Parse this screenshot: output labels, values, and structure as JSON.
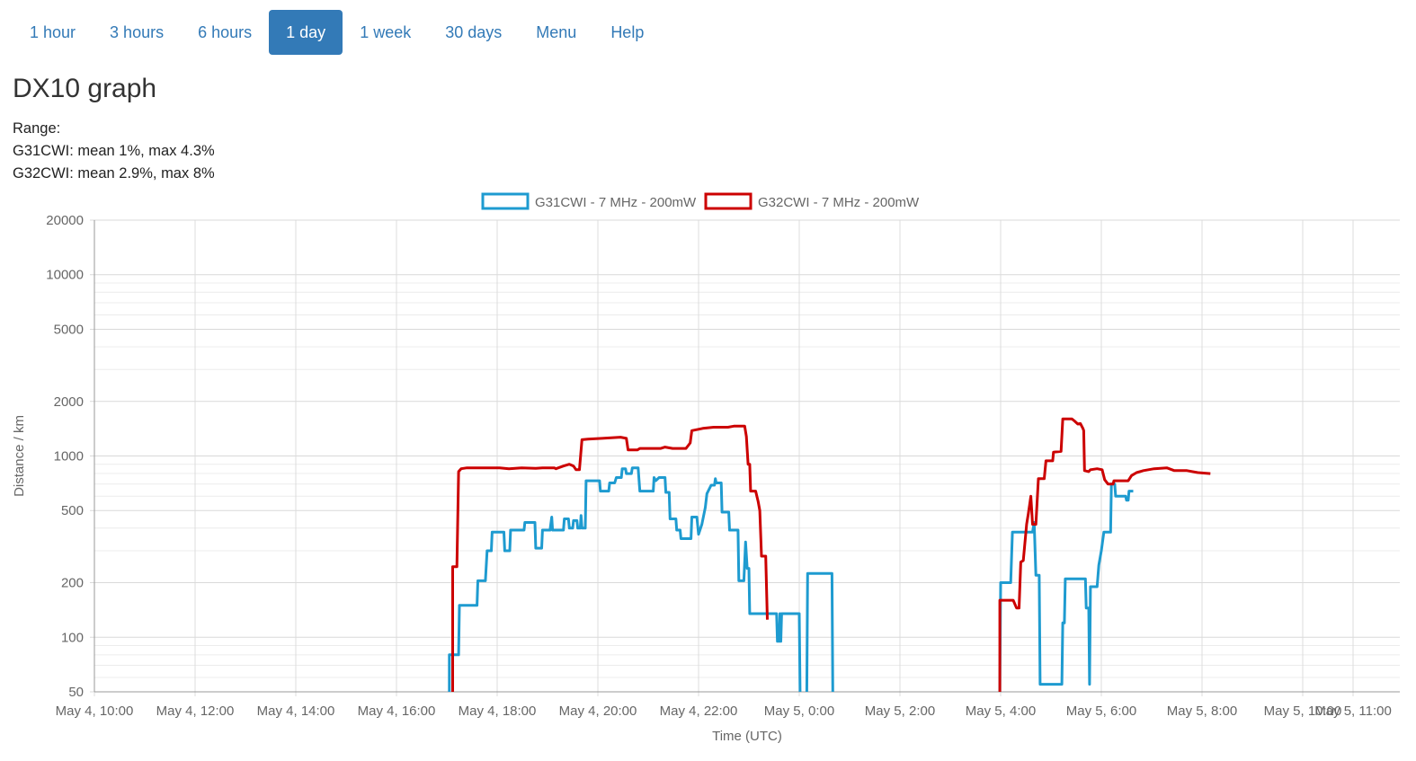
{
  "nav": {
    "tabs": [
      {
        "label": "1 hour",
        "active": false
      },
      {
        "label": "3 hours",
        "active": false
      },
      {
        "label": "6 hours",
        "active": false
      },
      {
        "label": "1 day",
        "active": true
      },
      {
        "label": "1 week",
        "active": false
      },
      {
        "label": "30 days",
        "active": false
      },
      {
        "label": "Menu",
        "active": false
      },
      {
        "label": "Help",
        "active": false
      }
    ]
  },
  "page": {
    "title": "DX10 graph",
    "range_label": "Range:",
    "stats": [
      "G31CWI: mean 1%, max 4.3%",
      "G32CWI: mean 2.9%, max 8%"
    ]
  },
  "chart_data": {
    "type": "line",
    "xlabel": "Time (UTC)",
    "ylabel": "Distance / km",
    "yscale": "log",
    "ylim": [
      50,
      20000
    ],
    "xlim": [
      "2019-05-04 10:00",
      "2019-05-05 11:00"
    ],
    "yticks": [
      50,
      100,
      200,
      500,
      1000,
      2000,
      5000,
      10000,
      20000
    ],
    "xticks": [
      "May 4, 10:00",
      "May 4, 12:00",
      "May 4, 14:00",
      "May 4, 16:00",
      "May 4, 18:00",
      "May 4, 20:00",
      "May 4, 22:00",
      "May 5, 0:00",
      "May 5, 2:00",
      "May 5, 4:00",
      "May 5, 6:00",
      "May 5, 8:00",
      "May 5, 10:00",
      "May 5, 11:00"
    ],
    "grid": true,
    "legend": "top-center",
    "series": [
      {
        "name": "G31CWI - 7 MHz - 200mW",
        "color": "#1e9bd0",
        "segments": [
          [
            [
              "2019-05-04 17:03",
              50
            ],
            [
              "2019-05-04 17:03",
              80
            ],
            [
              "2019-05-04 17:14",
              80
            ],
            [
              "2019-05-04 17:15",
              150
            ],
            [
              "2019-05-04 17:36",
              150
            ],
            [
              "2019-05-04 17:37",
              205
            ],
            [
              "2019-05-04 17:46",
              205
            ],
            [
              "2019-05-04 17:48",
              300
            ],
            [
              "2019-05-04 17:53",
              300
            ],
            [
              "2019-05-04 17:54",
              380
            ],
            [
              "2019-05-04 18:08",
              380
            ],
            [
              "2019-05-04 18:09",
              300
            ],
            [
              "2019-05-04 18:15",
              300
            ],
            [
              "2019-05-04 18:16",
              390
            ],
            [
              "2019-05-04 18:32",
              390
            ],
            [
              "2019-05-04 18:33",
              430
            ],
            [
              "2019-05-04 18:45",
              430
            ],
            [
              "2019-05-04 18:46",
              310
            ],
            [
              "2019-05-04 18:53",
              310
            ],
            [
              "2019-05-04 18:54",
              390
            ],
            [
              "2019-05-04 19:03",
              390
            ],
            [
              "2019-05-04 19:05",
              460
            ],
            [
              "2019-05-04 19:06",
              390
            ],
            [
              "2019-05-04 19:19",
              390
            ],
            [
              "2019-05-04 19:20",
              450
            ],
            [
              "2019-05-04 19:25",
              450
            ],
            [
              "2019-05-04 19:26",
              400
            ],
            [
              "2019-05-04 19:30",
              400
            ],
            [
              "2019-05-04 19:31",
              440
            ],
            [
              "2019-05-04 19:35",
              440
            ],
            [
              "2019-05-04 19:36",
              400
            ],
            [
              "2019-05-04 19:39",
              400
            ],
            [
              "2019-05-04 19:40",
              470
            ],
            [
              "2019-05-04 19:41",
              400
            ],
            [
              "2019-05-04 19:45",
              400
            ],
            [
              "2019-05-04 19:46",
              730
            ],
            [
              "2019-05-04 20:02",
              730
            ],
            [
              "2019-05-04 20:03",
              640
            ],
            [
              "2019-05-04 20:13",
              640
            ],
            [
              "2019-05-04 20:14",
              710
            ],
            [
              "2019-05-04 20:20",
              710
            ],
            [
              "2019-05-04 20:22",
              760
            ],
            [
              "2019-05-04 20:28",
              760
            ],
            [
              "2019-05-04 20:29",
              850
            ],
            [
              "2019-05-04 20:33",
              850
            ],
            [
              "2019-05-04 20:34",
              800
            ],
            [
              "2019-05-04 20:40",
              800
            ],
            [
              "2019-05-04 20:41",
              860
            ],
            [
              "2019-05-04 20:48",
              860
            ],
            [
              "2019-05-04 20:50",
              640
            ],
            [
              "2019-05-04 21:06",
              640
            ],
            [
              "2019-05-04 21:07",
              760
            ],
            [
              "2019-05-04 21:09",
              730
            ],
            [
              "2019-05-04 21:13",
              760
            ],
            [
              "2019-05-04 21:20",
              760
            ],
            [
              "2019-05-04 21:21",
              630
            ],
            [
              "2019-05-04 21:25",
              630
            ],
            [
              "2019-05-04 21:26",
              450
            ],
            [
              "2019-05-04 21:33",
              450
            ],
            [
              "2019-05-04 21:34",
              390
            ],
            [
              "2019-05-04 21:38",
              390
            ],
            [
              "2019-05-04 21:39",
              350
            ],
            [
              "2019-05-04 21:51",
              350
            ],
            [
              "2019-05-04 21:52",
              460
            ],
            [
              "2019-05-04 21:58",
              460
            ],
            [
              "2019-05-04 22:00",
              370
            ],
            [
              "2019-05-04 22:04",
              420
            ],
            [
              "2019-05-04 22:08",
              520
            ],
            [
              "2019-05-04 22:10",
              620
            ],
            [
              "2019-05-04 22:15",
              690
            ],
            [
              "2019-05-04 22:19",
              690
            ],
            [
              "2019-05-04 22:20",
              750
            ],
            [
              "2019-05-04 22:21",
              710
            ],
            [
              "2019-05-04 22:27",
              710
            ],
            [
              "2019-05-04 22:28",
              490
            ],
            [
              "2019-05-04 22:36",
              490
            ],
            [
              "2019-05-04 22:37",
              390
            ],
            [
              "2019-05-04 22:47",
              390
            ],
            [
              "2019-05-04 22:48",
              205
            ],
            [
              "2019-05-04 22:54",
              205
            ],
            [
              "2019-05-04 22:56",
              335
            ],
            [
              "2019-05-04 22:58",
              240
            ],
            [
              "2019-05-04 23:00",
              240
            ],
            [
              "2019-05-04 23:01",
              135
            ],
            [
              "2019-05-04 23:33",
              135
            ],
            [
              "2019-05-04 23:34",
              95
            ],
            [
              "2019-05-04 23:36",
              95
            ],
            [
              "2019-05-04 23:37",
              135
            ],
            [
              "2019-05-04 23:38",
              95
            ],
            [
              "2019-05-04 23:39",
              135
            ],
            [
              "2019-05-05 00:00",
              135
            ],
            [
              "2019-05-05 00:01",
              50
            ]
          ],
          [
            [
              "2019-05-05 00:09",
              50
            ],
            [
              "2019-05-05 00:10",
              225
            ],
            [
              "2019-05-05 00:39",
              225
            ],
            [
              "2019-05-05 00:40",
              50
            ]
          ],
          [
            [
              "2019-05-05 03:59",
              50
            ],
            [
              "2019-05-05 04:00",
              200
            ],
            [
              "2019-05-05 04:12",
              200
            ],
            [
              "2019-05-05 04:14",
              380
            ],
            [
              "2019-05-05 04:38",
              380
            ],
            [
              "2019-05-05 04:40",
              430
            ],
            [
              "2019-05-05 04:42",
              220
            ],
            [
              "2019-05-05 04:46",
              220
            ],
            [
              "2019-05-05 04:47",
              55
            ],
            [
              "2019-05-05 05:13",
              55
            ],
            [
              "2019-05-05 05:14",
              120
            ],
            [
              "2019-05-05 05:16",
              120
            ],
            [
              "2019-05-05 05:17",
              210
            ],
            [
              "2019-05-05 05:41",
              210
            ],
            [
              "2019-05-05 05:42",
              145
            ],
            [
              "2019-05-05 05:45",
              145
            ],
            [
              "2019-05-05 05:46",
              55
            ],
            [
              "2019-05-05 05:47",
              190
            ],
            [
              "2019-05-05 05:55",
              190
            ],
            [
              "2019-05-05 05:57",
              250
            ],
            [
              "2019-05-05 06:00",
              300
            ],
            [
              "2019-05-05 06:03",
              380
            ],
            [
              "2019-05-05 06:11",
              380
            ],
            [
              "2019-05-05 06:12",
              700
            ],
            [
              "2019-05-05 06:16",
              700
            ],
            [
              "2019-05-05 06:17",
              600
            ],
            [
              "2019-05-05 06:29",
              600
            ],
            [
              "2019-05-05 06:30",
              570
            ],
            [
              "2019-05-05 06:32",
              570
            ],
            [
              "2019-05-05 06:33",
              640
            ],
            [
              "2019-05-05 06:38",
              640
            ]
          ]
        ]
      },
      {
        "name": "G32CWI - 7 MHz - 200mW",
        "color": "#cc0000",
        "segments": [
          [
            [
              "2019-05-04 17:07",
              50
            ],
            [
              "2019-05-04 17:07",
              245
            ],
            [
              "2019-05-04 17:12",
              245
            ],
            [
              "2019-05-04 17:14",
              820
            ],
            [
              "2019-05-04 17:17",
              850
            ],
            [
              "2019-05-04 17:24",
              860
            ],
            [
              "2019-05-04 17:46",
              860
            ],
            [
              "2019-05-04 18:03",
              860
            ],
            [
              "2019-05-04 18:14",
              850
            ],
            [
              "2019-05-04 18:29",
              860
            ],
            [
              "2019-05-04 18:46",
              855
            ],
            [
              "2019-05-04 18:54",
              860
            ],
            [
              "2019-05-04 19:08",
              860
            ],
            [
              "2019-05-04 19:10",
              850
            ],
            [
              "2019-05-04 19:19",
              880
            ],
            [
              "2019-05-04 19:26",
              900
            ],
            [
              "2019-05-04 19:31",
              880
            ],
            [
              "2019-05-04 19:34",
              840
            ],
            [
              "2019-05-04 19:38",
              840
            ],
            [
              "2019-05-04 19:41",
              1230
            ],
            [
              "2019-05-04 19:48",
              1240
            ],
            [
              "2019-05-04 20:05",
              1250
            ],
            [
              "2019-05-04 20:27",
              1270
            ],
            [
              "2019-05-04 20:34",
              1250
            ],
            [
              "2019-05-04 20:36",
              1080
            ],
            [
              "2019-05-04 20:47",
              1080
            ],
            [
              "2019-05-04 20:50",
              1100
            ],
            [
              "2019-05-04 21:15",
              1100
            ],
            [
              "2019-05-04 21:20",
              1120
            ],
            [
              "2019-05-04 21:29",
              1100
            ],
            [
              "2019-05-04 21:45",
              1100
            ],
            [
              "2019-05-04 21:50",
              1180
            ],
            [
              "2019-05-04 21:52",
              1380
            ],
            [
              "2019-05-04 22:05",
              1420
            ],
            [
              "2019-05-04 22:18",
              1440
            ],
            [
              "2019-05-04 22:35",
              1440
            ],
            [
              "2019-05-04 22:42",
              1460
            ],
            [
              "2019-05-04 22:55",
              1460
            ],
            [
              "2019-05-04 22:57",
              1280
            ],
            [
              "2019-05-04 22:59",
              900
            ],
            [
              "2019-05-04 23:01",
              900
            ],
            [
              "2019-05-04 23:02",
              640
            ],
            [
              "2019-05-04 23:08",
              640
            ],
            [
              "2019-05-04 23:11",
              560
            ],
            [
              "2019-05-04 23:13",
              500
            ],
            [
              "2019-05-04 23:15",
              280
            ],
            [
              "2019-05-04 23:20",
              280
            ],
            [
              "2019-05-04 23:22",
              125
            ]
          ],
          [
            [
              "2019-05-05 03:59",
              50
            ],
            [
              "2019-05-05 03:59",
              160
            ],
            [
              "2019-05-05 04:15",
              160
            ],
            [
              "2019-05-05 04:19",
              145
            ],
            [
              "2019-05-05 04:22",
              145
            ],
            [
              "2019-05-05 04:24",
              260
            ],
            [
              "2019-05-05 04:27",
              265
            ],
            [
              "2019-05-05 04:31",
              420
            ],
            [
              "2019-05-05 04:33",
              480
            ],
            [
              "2019-05-05 04:36",
              600
            ],
            [
              "2019-05-05 04:38",
              420
            ],
            [
              "2019-05-05 04:42",
              420
            ],
            [
              "2019-05-05 04:45",
              750
            ],
            [
              "2019-05-05 04:52",
              750
            ],
            [
              "2019-05-05 04:54",
              940
            ],
            [
              "2019-05-05 05:02",
              940
            ],
            [
              "2019-05-05 05:03",
              1050
            ],
            [
              "2019-05-05 05:12",
              1060
            ],
            [
              "2019-05-05 05:14",
              1600
            ],
            [
              "2019-05-05 05:25",
              1600
            ],
            [
              "2019-05-05 05:28",
              1560
            ],
            [
              "2019-05-05 05:32",
              1500
            ],
            [
              "2019-05-05 05:35",
              1510
            ],
            [
              "2019-05-05 05:38",
              1420
            ],
            [
              "2019-05-05 05:39",
              1380
            ],
            [
              "2019-05-05 05:40",
              830
            ],
            [
              "2019-05-05 05:45",
              820
            ],
            [
              "2019-05-05 05:47",
              840
            ],
            [
              "2019-05-05 05:55",
              850
            ],
            [
              "2019-05-05 06:01",
              840
            ],
            [
              "2019-05-05 06:04",
              740
            ],
            [
              "2019-05-05 06:08",
              700
            ],
            [
              "2019-05-05 06:14",
              700
            ],
            [
              "2019-05-05 06:15",
              730
            ],
            [
              "2019-05-05 06:32",
              730
            ],
            [
              "2019-05-05 06:36",
              780
            ],
            [
              "2019-05-05 06:42",
              810
            ],
            [
              "2019-05-05 06:50",
              830
            ],
            [
              "2019-05-05 07:03",
              850
            ],
            [
              "2019-05-05 07:18",
              860
            ],
            [
              "2019-05-05 07:27",
              830
            ],
            [
              "2019-05-05 07:42",
              830
            ],
            [
              "2019-05-05 07:55",
              810
            ],
            [
              "2019-05-05 08:10",
              800
            ]
          ]
        ]
      }
    ]
  }
}
